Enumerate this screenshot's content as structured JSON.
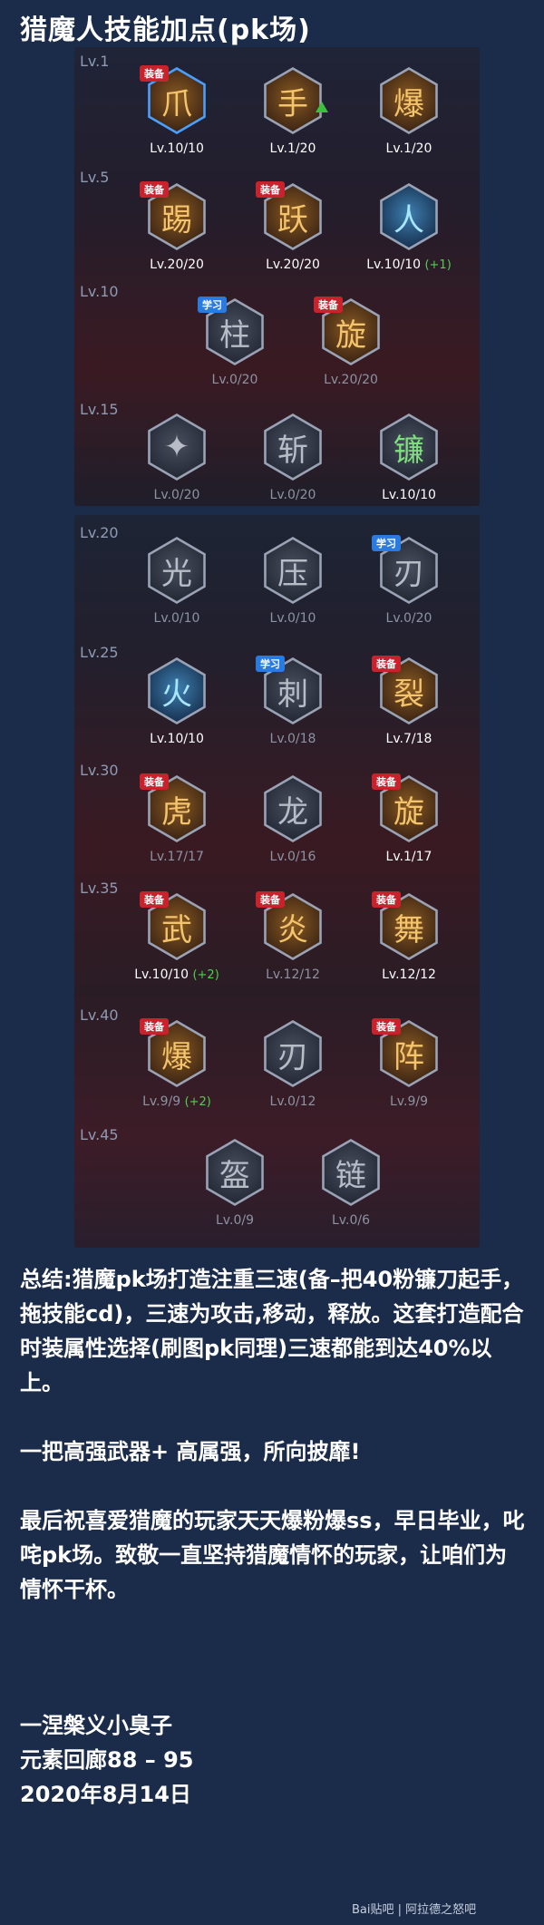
{
  "title": "猎魔人技能加点(pk场)",
  "levels_a": [
    "Lv.1",
    "Lv.5",
    "Lv.10",
    "Lv.15"
  ],
  "levels_b": [
    "Lv.20",
    "Lv.25",
    "Lv.30",
    "Lv.35",
    "Lv.40",
    "Lv.45"
  ],
  "badges": {
    "equip": "装备",
    "learn": "学习"
  },
  "skills": {
    "r1": [
      {
        "lv": "Lv.10/10",
        "icon": "爪"
      },
      {
        "lv": "Lv.1/20",
        "icon": "手"
      },
      {
        "lv": "Lv.1/20",
        "icon": "爆"
      }
    ],
    "r2": [
      {
        "lv": "Lv.20/20",
        "icon": "踢"
      },
      {
        "lv": "Lv.20/20",
        "icon": "跃"
      },
      {
        "lv": "Lv.10/10",
        "bonus": "(+1)",
        "icon": "人"
      }
    ],
    "r3": [
      {
        "lv": "Lv.0/20",
        "icon": "柱"
      },
      {
        "lv": "Lv.20/20",
        "icon": "旋"
      }
    ],
    "r4": [
      {
        "lv": "Lv.0/20",
        "icon": "✦"
      },
      {
        "lv": "Lv.0/20",
        "icon": "斩"
      },
      {
        "lv": "Lv.10/10",
        "icon": "镰"
      }
    ],
    "r5": [
      {
        "lv": "Lv.0/10",
        "icon": "光"
      },
      {
        "lv": "Lv.0/10",
        "icon": "压"
      },
      {
        "lv": "Lv.0/20",
        "icon": "刃"
      }
    ],
    "r6": [
      {
        "lv": "Lv.10/10",
        "icon": "火"
      },
      {
        "lv": "Lv.0/18",
        "icon": "刺"
      },
      {
        "lv": "Lv.7/18",
        "icon": "裂"
      }
    ],
    "r7": [
      {
        "lv": "Lv.17/17",
        "icon": "虎"
      },
      {
        "lv": "Lv.0/16",
        "icon": "龙"
      },
      {
        "lv": "Lv.1/17",
        "icon": "旋"
      }
    ],
    "r8": [
      {
        "lv": "Lv.10/10",
        "bonus": "(+2)",
        "icon": "武"
      },
      {
        "lv": "Lv.12/12",
        "icon": "炎"
      },
      {
        "lv": "Lv.12/12",
        "icon": "舞"
      }
    ],
    "r9": [
      {
        "lv": "Lv.9/9",
        "bonus": "(+2)",
        "icon": "爆"
      },
      {
        "lv": "Lv.0/12",
        "icon": "刃"
      },
      {
        "lv": "Lv.9/9",
        "icon": "阵"
      }
    ],
    "r10": [
      {
        "lv": "Lv.0/9",
        "icon": "盔"
      },
      {
        "lv": "Lv.0/6",
        "icon": "链"
      }
    ]
  },
  "summary": "总结:猎魔pk场打造注重三速(备–把40粉镰刀起手，拖技能cd)，三速为攻击,移动，释放。这套打造配合时装属性选择(刷图pk同理)三速都能到达40%以上。",
  "summary2": "一把高强武器+ 高属强，所向披靡!",
  "wish": "最后祝喜爱猎魔的玩家天天爆粉爆ss，早日毕业，叱咤pk场。致敬一直坚持猎魔情怀的玩家，让咱们为情怀干杯。",
  "author": "一涅槃义小臭子",
  "server": "元素回廊88 – 95",
  "date": "2020年8月14日",
  "watermark": "Bai贴吧 | 阿拉德之怒吧"
}
